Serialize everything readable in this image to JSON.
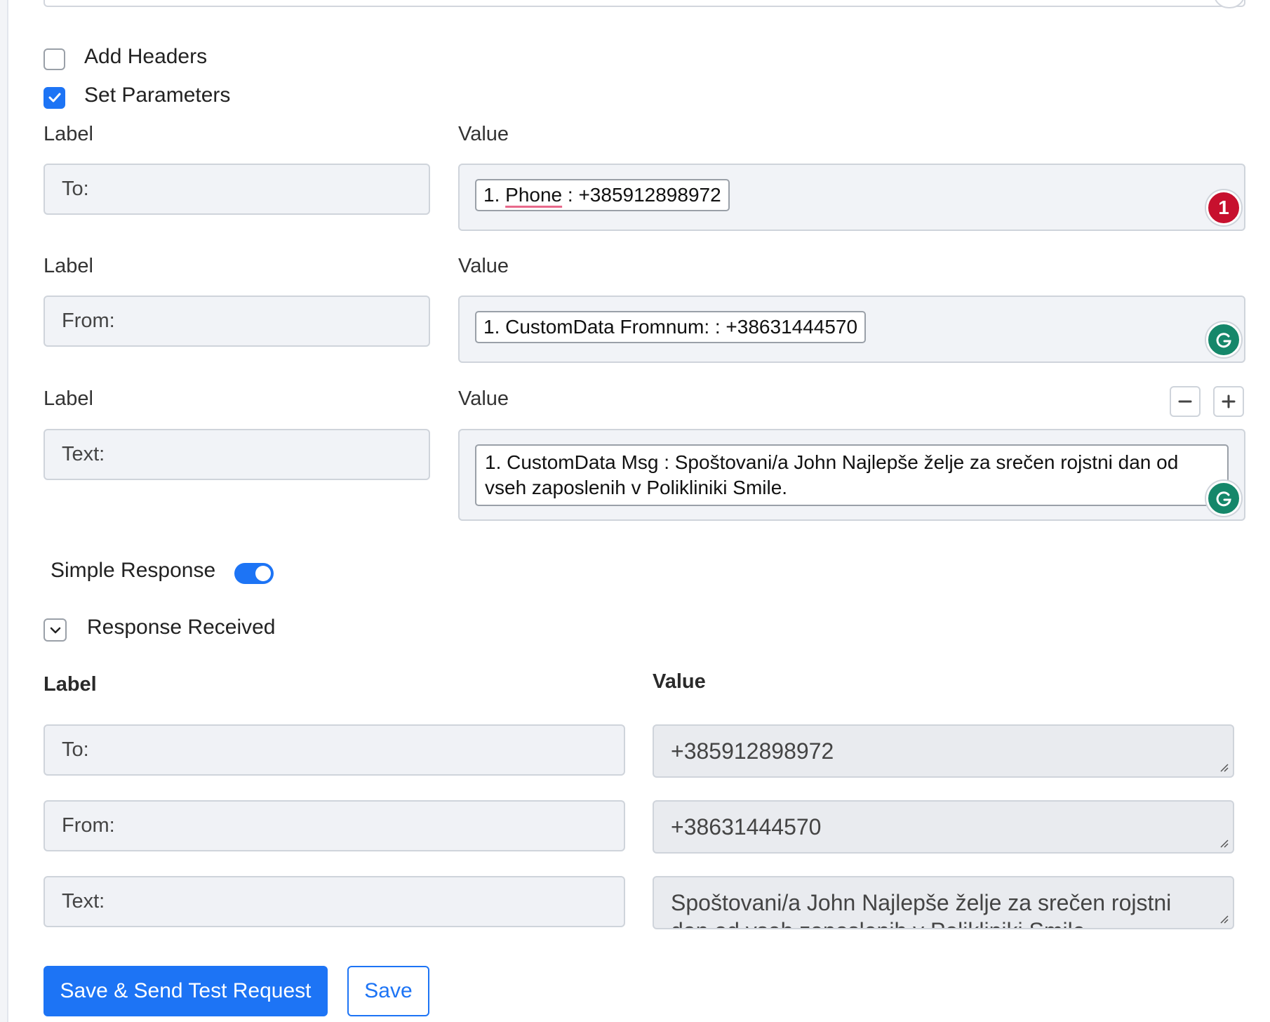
{
  "options": {
    "add_headers": {
      "label": "Add Headers",
      "checked": false
    },
    "set_parameters": {
      "label": "Set Parameters",
      "checked": true
    }
  },
  "parameters": [
    {
      "label_heading": "Label",
      "value_heading": "Value",
      "label": "To:",
      "value": "1. Phone : +385912898972",
      "badge": "1"
    },
    {
      "label_heading": "Label",
      "value_heading": "Value",
      "label": "From:",
      "value": "1. CustomData Fromnum: : +38631444570"
    },
    {
      "label_heading": "Label",
      "value_heading": "Value",
      "label": "Text:",
      "value": "1. CustomData Msg : Spoštovani/a John Najlepše želje za srečen rojstni dan od vseh zaposlenih v Polikliniki Smile."
    }
  ],
  "simple_response": {
    "label": "Simple Response",
    "on": true
  },
  "response_received": {
    "label": "Response Received",
    "label_heading": "Label",
    "value_heading": "Value",
    "rows": [
      {
        "label": "To:",
        "value": "+385912898972"
      },
      {
        "label": "From:",
        "value": "+38631444570"
      },
      {
        "label": "Text:",
        "value": "Spoštovani/a John Najlepše želje za srečen rojstni dan od vseh zaposlenih v Polikliniki Smile."
      }
    ]
  },
  "buttons": {
    "save_send": "Save & Send Test Request",
    "save": "Save"
  },
  "colors": {
    "accent": "#1d74f5",
    "badge_red": "#c7102e",
    "grammarly_green": "#15876a"
  }
}
